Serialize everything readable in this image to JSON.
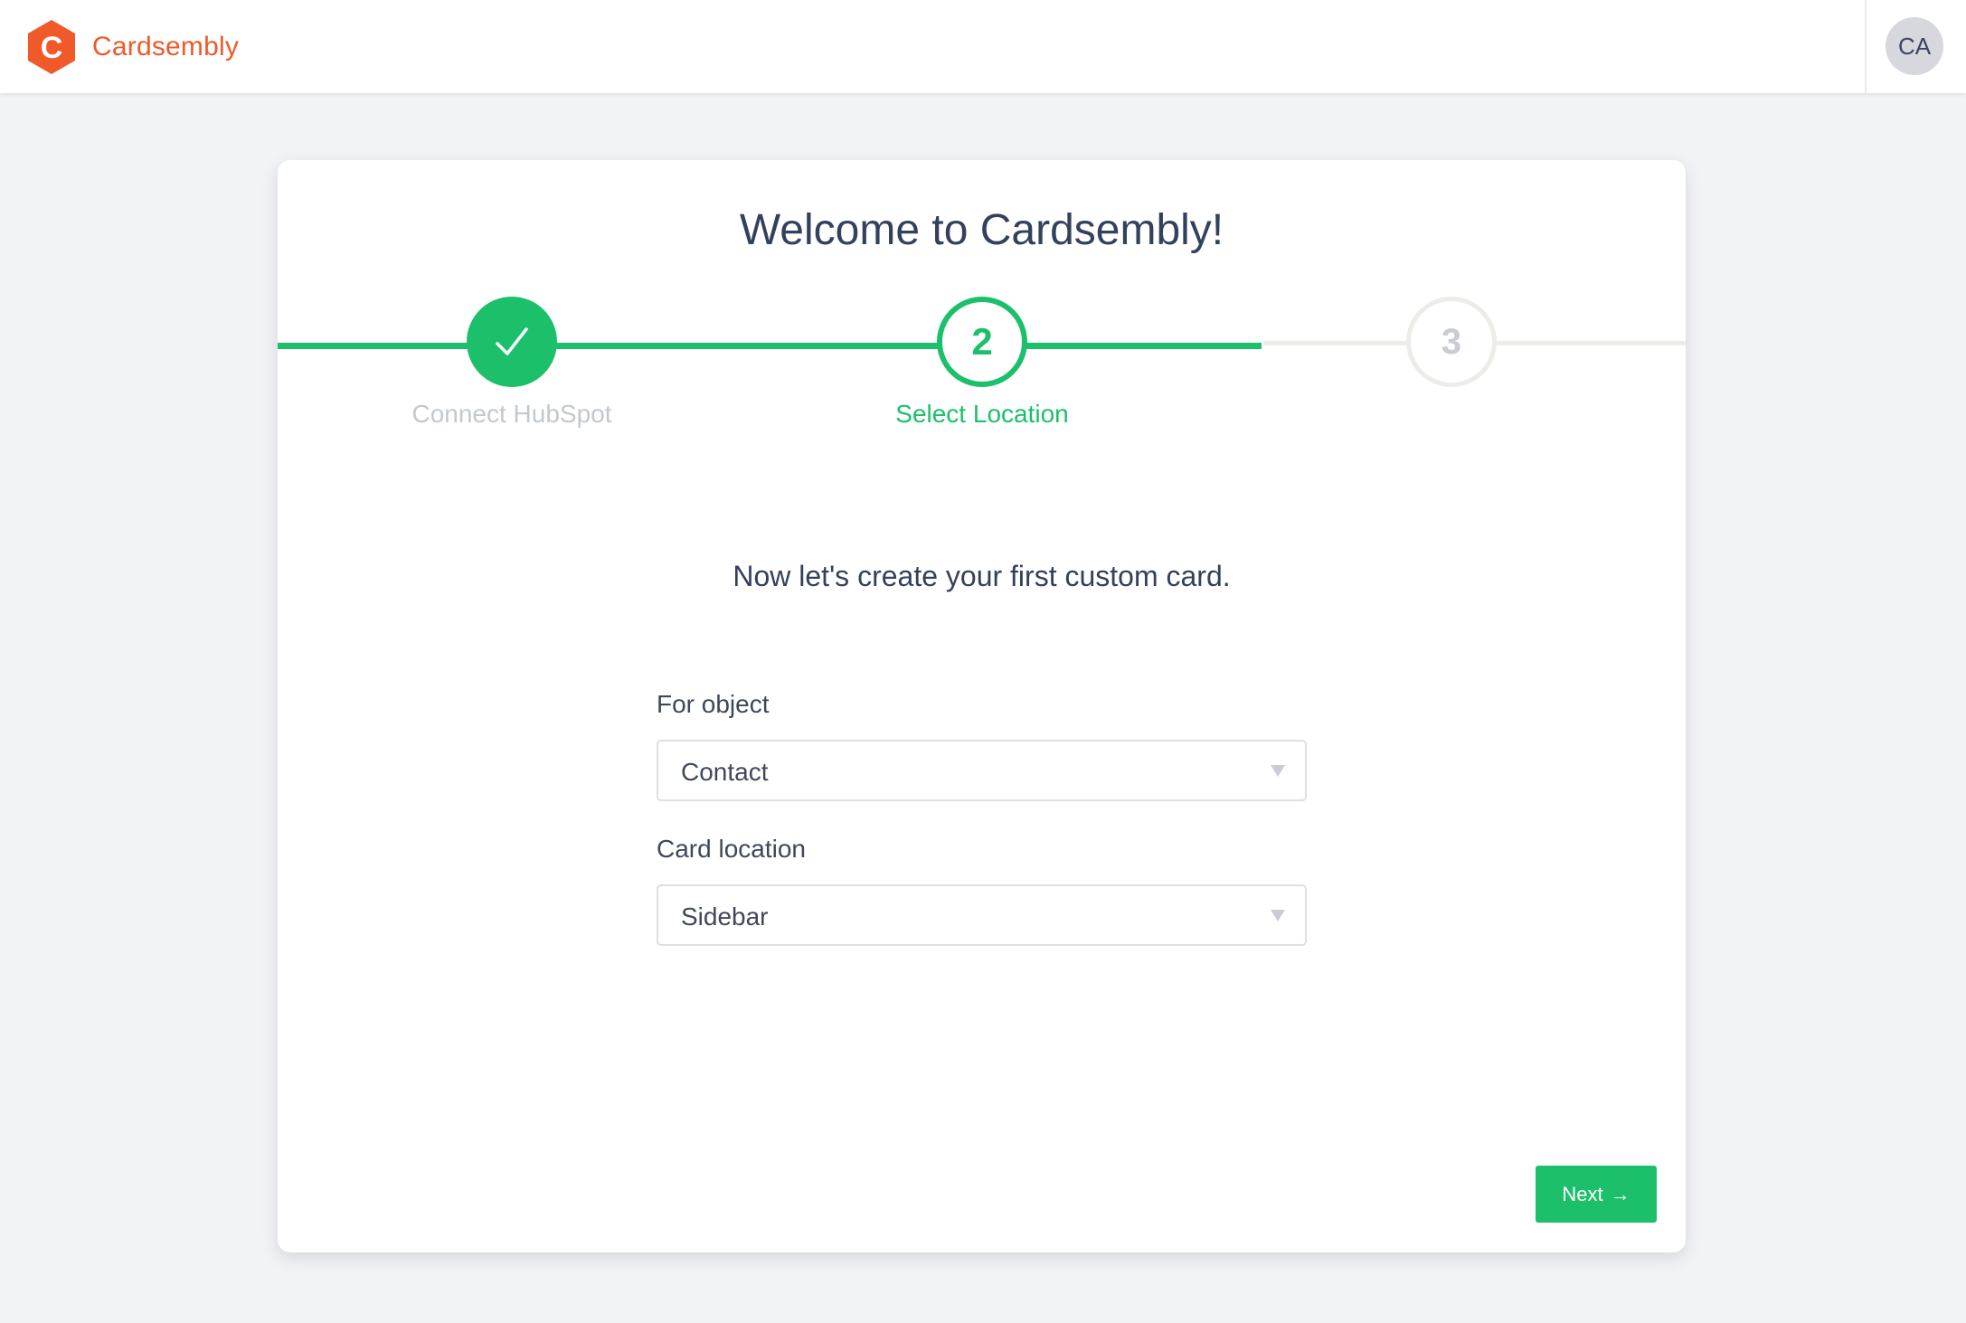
{
  "header": {
    "brand_name": "Cardsembly",
    "logo_letter": "C",
    "avatar_initials": "CA"
  },
  "onboarding": {
    "title": "Welcome to Cardsembly!",
    "steps": [
      {
        "number": "1",
        "label": "Connect HubSpot",
        "status": "completed"
      },
      {
        "number": "2",
        "label": "Select Location",
        "status": "active"
      },
      {
        "number": "3",
        "label": "",
        "status": "pending"
      }
    ],
    "subtitle": "Now let's create your first custom card.",
    "form": {
      "object_label": "For object",
      "object_value": "Contact",
      "location_label": "Card location",
      "location_value": "Sidebar"
    },
    "next_label": "Next",
    "next_arrow": "→"
  },
  "colors": {
    "accent_green": "#1cc06b",
    "brand_orange": "#f0592a",
    "text_dark": "#33415c"
  },
  "icons": {
    "logo": "hexagon-c-icon",
    "completed_step": "check-icon",
    "select_toggle": "chevron-down-icon",
    "next": "arrow-right-icon"
  }
}
